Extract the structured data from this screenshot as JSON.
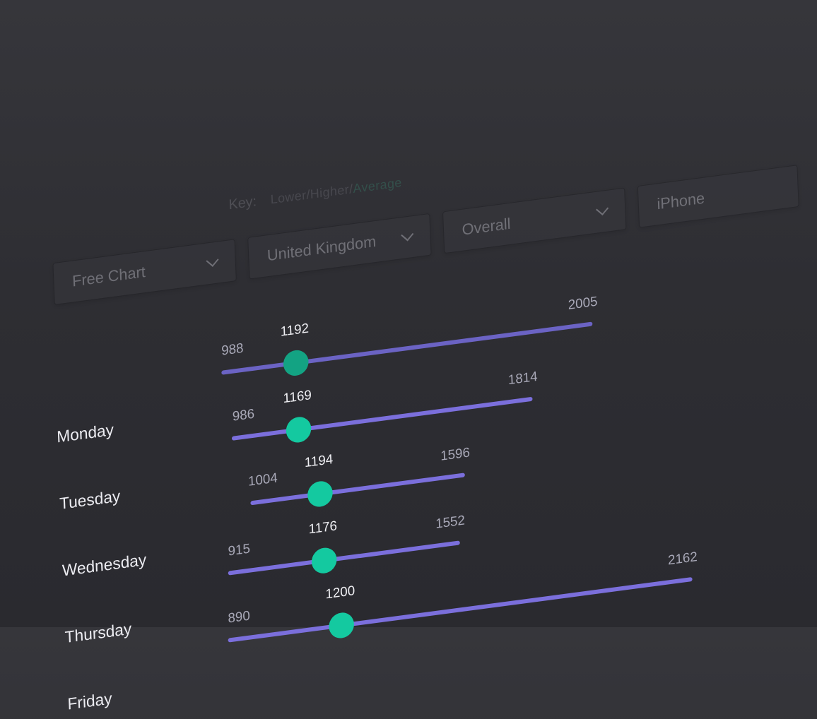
{
  "key": {
    "label": "Key:",
    "text_left": "Lower/Higher/",
    "text_right": "Average"
  },
  "filters": {
    "chart": "Free Chart",
    "country": "United Kingdom",
    "category": "Overall",
    "device": "iPhone"
  },
  "rows": [
    {
      "day": "Monday",
      "min": "988",
      "max": "2005",
      "value": "1192"
    },
    {
      "day": "Tuesday",
      "min": "986",
      "max": "1814",
      "value": "1169"
    },
    {
      "day": "Wednesday",
      "min": "1004",
      "max": "1596",
      "value": "1194"
    },
    {
      "day": "Thursday",
      "min": "915",
      "max": "1552",
      "value": "1176"
    },
    {
      "day": "Friday",
      "min": "890",
      "max": "2162",
      "value": "1200"
    }
  ],
  "colors": {
    "track": "#7b6fdc",
    "thumb": "#14c9a0",
    "background": "#2e2e33"
  }
}
